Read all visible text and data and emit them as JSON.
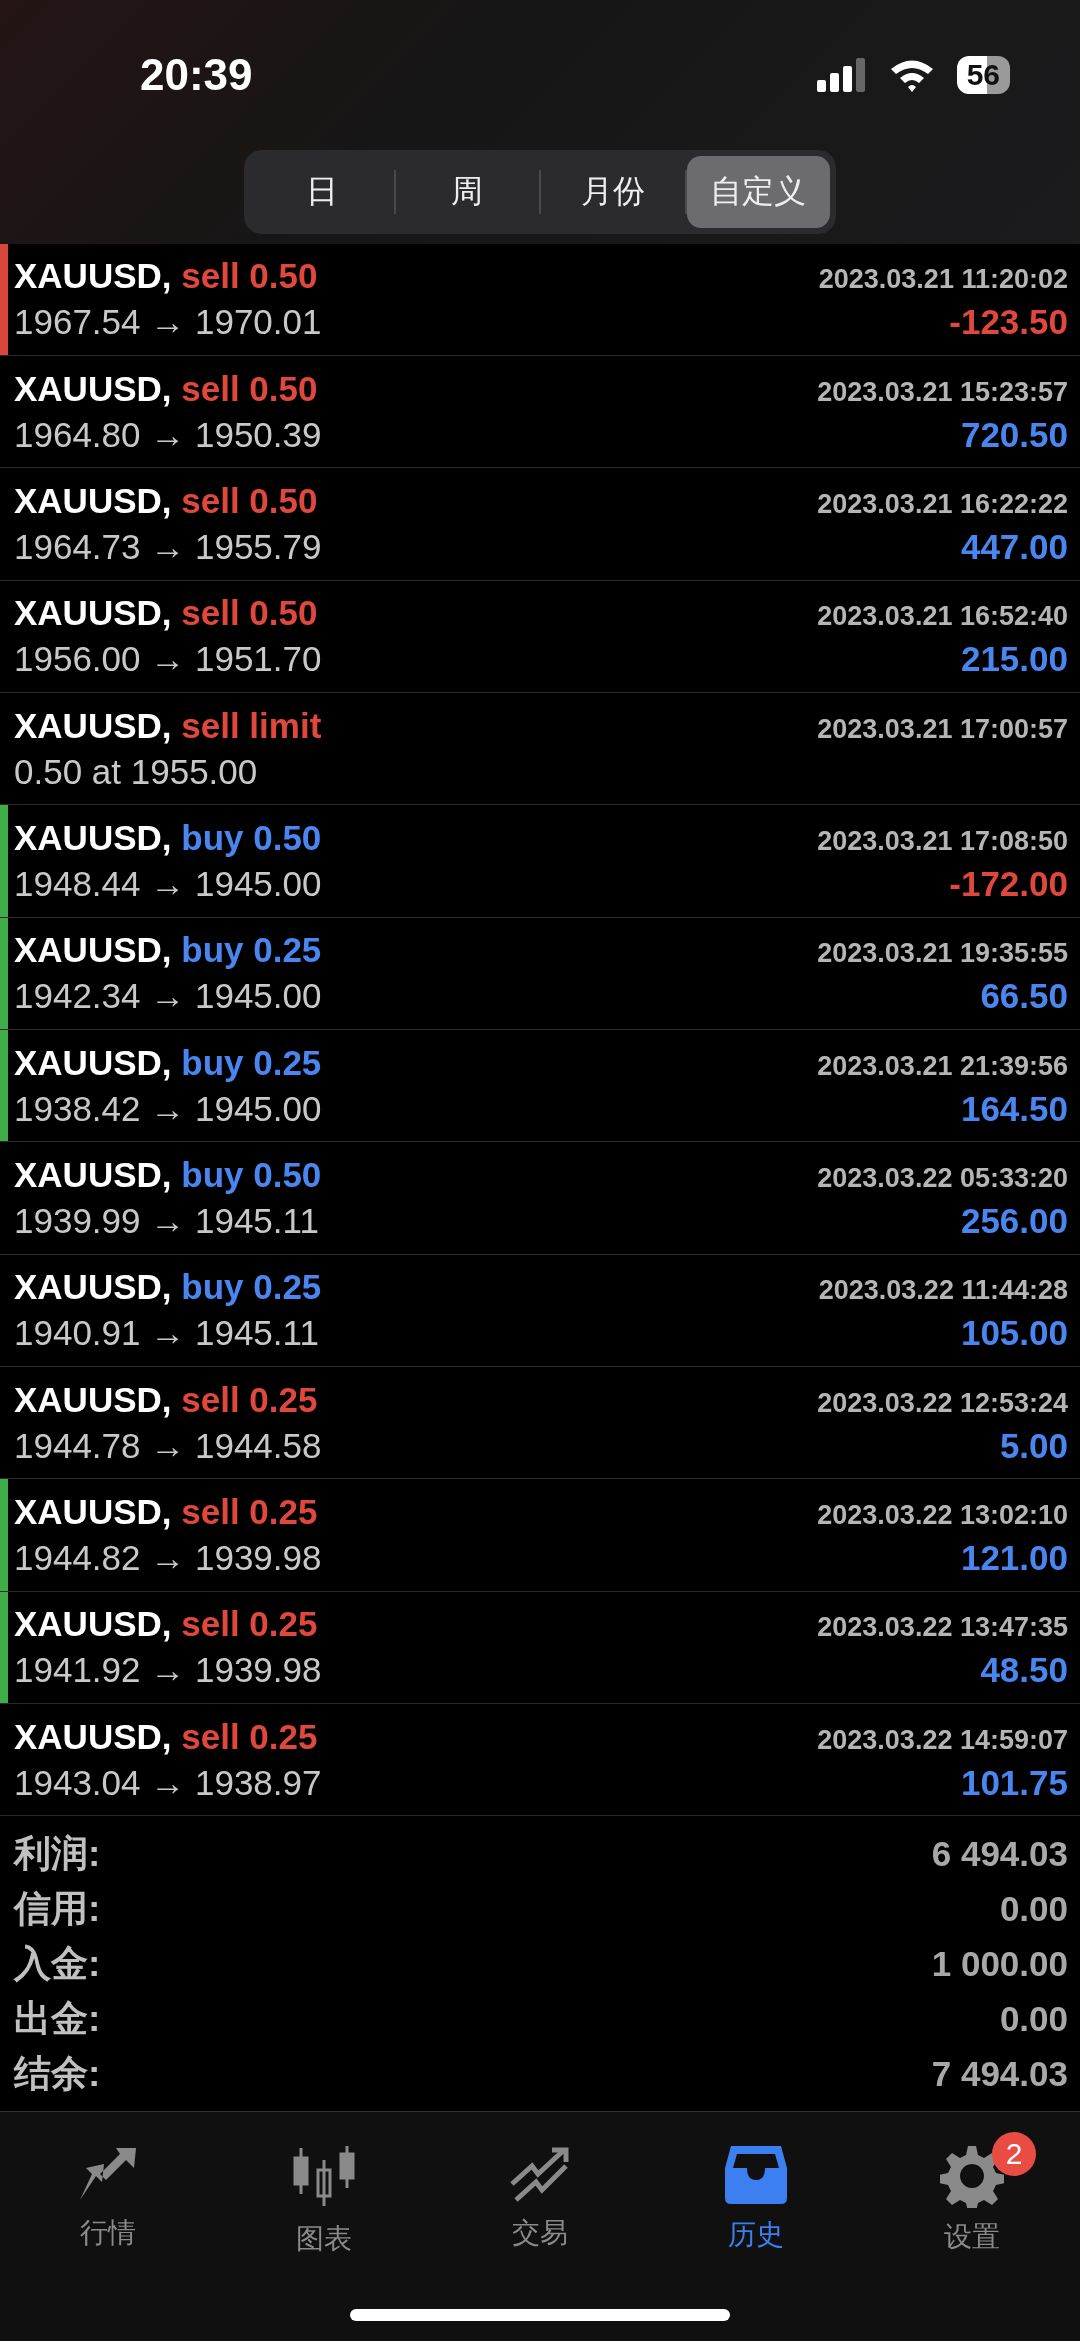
{
  "status_bar": {
    "time": "20:39",
    "battery": "56"
  },
  "period_tabs": [
    {
      "label": "日",
      "selected": false
    },
    {
      "label": "周",
      "selected": false
    },
    {
      "label": "月份",
      "selected": false
    },
    {
      "label": "自定义",
      "selected": true
    }
  ],
  "trades": [
    {
      "symbol": "XAUUSD,",
      "action": "sell 0.50",
      "kind": "sell",
      "time": "2023.03.21 11:20:02",
      "prices": "1967.54 → 1970.01",
      "profit": "-123.50",
      "loss": true,
      "color": "#d9463b"
    },
    {
      "symbol": "XAUUSD,",
      "action": "sell 0.50",
      "kind": "sell",
      "time": "2023.03.21 15:23:57",
      "prices": "1964.80 → 1950.39",
      "profit": "720.50",
      "loss": false
    },
    {
      "symbol": "XAUUSD,",
      "action": "sell 0.50",
      "kind": "sell",
      "time": "2023.03.21 16:22:22",
      "prices": "1964.73 → 1955.79",
      "profit": "447.00",
      "loss": false
    },
    {
      "symbol": "XAUUSD,",
      "action": "sell 0.50",
      "kind": "sell",
      "time": "2023.03.21 16:52:40",
      "prices": "1956.00 → 1951.70",
      "profit": "215.00",
      "loss": false
    },
    {
      "symbol": "XAUUSD,",
      "action": "sell limit",
      "kind": "sell",
      "time": "2023.03.21 17:00:57",
      "prices": "0.50 at 1955.00"
    },
    {
      "symbol": "XAUUSD,",
      "action": "buy 0.50",
      "kind": "buy",
      "time": "2023.03.21 17:08:50",
      "prices": "1948.44 → 1945.00",
      "profit": "-172.00",
      "loss": true,
      "color": "#3fae49"
    },
    {
      "symbol": "XAUUSD,",
      "action": "buy 0.25",
      "kind": "buy",
      "time": "2023.03.21 19:35:55",
      "prices": "1942.34 → 1945.00",
      "profit": "66.50",
      "loss": false,
      "color": "#3fae49"
    },
    {
      "symbol": "XAUUSD,",
      "action": "buy 0.25",
      "kind": "buy",
      "time": "2023.03.21 21:39:56",
      "prices": "1938.42 → 1945.00",
      "profit": "164.50",
      "loss": false,
      "color": "#3fae49"
    },
    {
      "symbol": "XAUUSD,",
      "action": "buy 0.50",
      "kind": "buy",
      "time": "2023.03.22 05:33:20",
      "prices": "1939.99 → 1945.11",
      "profit": "256.00",
      "loss": false
    },
    {
      "symbol": "XAUUSD,",
      "action": "buy 0.25",
      "kind": "buy",
      "time": "2023.03.22 11:44:28",
      "prices": "1940.91 → 1945.11",
      "profit": "105.00",
      "loss": false
    },
    {
      "symbol": "XAUUSD,",
      "action": "sell 0.25",
      "kind": "sell",
      "time": "2023.03.22 12:53:24",
      "prices": "1944.78 → 1944.58",
      "profit": "5.00",
      "loss": false
    },
    {
      "symbol": "XAUUSD,",
      "action": "sell 0.25",
      "kind": "sell",
      "time": "2023.03.22 13:02:10",
      "prices": "1944.82 → 1939.98",
      "profit": "121.00",
      "loss": false,
      "color": "#3fae49"
    },
    {
      "symbol": "XAUUSD,",
      "action": "sell 0.25",
      "kind": "sell",
      "time": "2023.03.22 13:47:35",
      "prices": "1941.92 → 1939.98",
      "profit": "48.50",
      "loss": false,
      "color": "#3fae49"
    },
    {
      "symbol": "XAUUSD,",
      "action": "sell 0.25",
      "kind": "sell",
      "time": "2023.03.22 14:59:07",
      "prices": "1943.04 → 1938.97",
      "profit": "101.75",
      "loss": false
    }
  ],
  "summary": [
    {
      "label": "利润:",
      "value": "6 494.03"
    },
    {
      "label": "信用:",
      "value": "0.00"
    },
    {
      "label": "入金:",
      "value": "1 000.00"
    },
    {
      "label": "出金:",
      "value": "0.00"
    },
    {
      "label": "结余:",
      "value": "7 494.03"
    }
  ],
  "bottom_nav": [
    {
      "label": "行情",
      "kind": "quotes",
      "selected": false
    },
    {
      "label": "图表",
      "kind": "chart",
      "selected": false
    },
    {
      "label": "交易",
      "kind": "trade",
      "selected": false
    },
    {
      "label": "历史",
      "kind": "history",
      "selected": true
    },
    {
      "label": "设置",
      "kind": "settings",
      "selected": false,
      "badge": "2"
    }
  ]
}
